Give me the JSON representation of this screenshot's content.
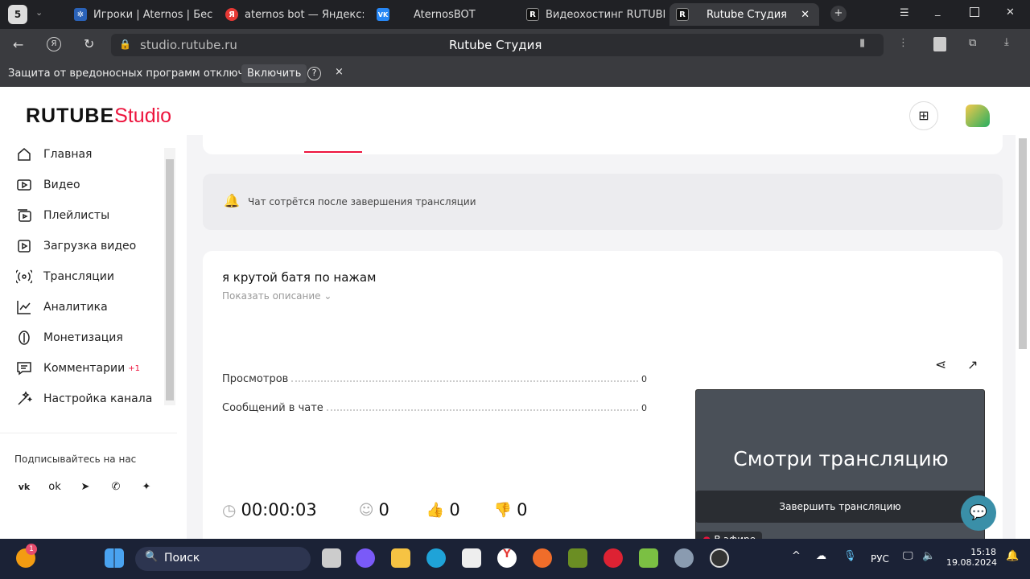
{
  "browser": {
    "tab_count": "5",
    "tabs": [
      {
        "label": "Игроки | Aternos | Бесп",
        "color": "#2a62b8",
        "glyph": "✲"
      },
      {
        "label": "aternos bot — Яндекс: н",
        "color": "#e53935",
        "glyph": "Я"
      },
      {
        "label": "AternosBOT",
        "color": "#2787f5",
        "glyph": "VK"
      },
      {
        "label": "Видеохостинг RUTUBE",
        "color": "#222",
        "glyph": "R"
      },
      {
        "label": "Rutube Студия",
        "color": "#222",
        "glyph": "R"
      }
    ],
    "url": "studio.rutube.ru",
    "page_title": "Rutube Студия",
    "warning": "Защита от вредоносных программ отключена",
    "enable_label": "Включить",
    "help": "?",
    "close": "×"
  },
  "logo": {
    "brand": "RUTUBE",
    "studio": "Studio"
  },
  "sidebar": {
    "items": [
      {
        "label": "Главная",
        "icon": "home-icon"
      },
      {
        "label": "Видео",
        "icon": "video-icon"
      },
      {
        "label": "Плейлисты",
        "icon": "playlist-icon"
      },
      {
        "label": "Загрузка видео",
        "icon": "upload-icon"
      },
      {
        "label": "Трансляции",
        "icon": "broadcast-icon"
      },
      {
        "label": "Аналитика",
        "icon": "analytics-icon"
      },
      {
        "label": "Монетизация",
        "icon": "monetization-icon"
      },
      {
        "label": "Комментарии",
        "icon": "comments-icon",
        "badge": "+1"
      },
      {
        "label": "Настройка канала",
        "icon": "settings-icon"
      }
    ],
    "follow_label": "Подписывайтесь на нас",
    "socials": [
      "vk",
      "ok",
      "telegram",
      "viber",
      "zen"
    ]
  },
  "notice": "Чат сотрётся после завершения трансляции",
  "stream": {
    "title": "я крутой батя по нажам",
    "show_description": "Показать описание",
    "stats": [
      {
        "label": "Просмотров",
        "value": "0"
      },
      {
        "label": "Сообщений в чате",
        "value": "0"
      }
    ],
    "duration": "00:00:03",
    "viewers": "0",
    "likes": "0",
    "dislikes": "0",
    "preview_text": "Смотри трансляцию",
    "live_label": "В эфире",
    "end_button": "Завершить трансляцию"
  },
  "taskbar": {
    "search": "Поиск",
    "lang": "РУС",
    "time": "15:18",
    "date": "19.08.2024",
    "notif": "1"
  }
}
